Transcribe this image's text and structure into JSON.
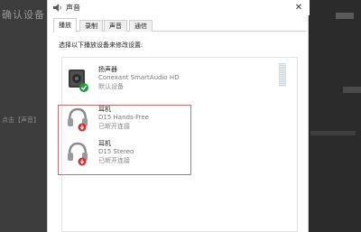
{
  "background": {
    "title": "确认设备",
    "side_text": "点击【声音】"
  },
  "dialog": {
    "title": "声音",
    "close_symbol": "✕"
  },
  "tabs": [
    {
      "label": "播放",
      "active": true
    },
    {
      "label": "录制",
      "active": false
    },
    {
      "label": "声音",
      "active": false
    },
    {
      "label": "通信",
      "active": false
    }
  ],
  "panel_label": "选择以下播放设备来修改设置:",
  "devices": [
    {
      "name": "扬声器",
      "subtitle": "Conexant SmartAudio HD",
      "status": "默认设备",
      "icon": "speaker-icon",
      "badge": "default-check-icon"
    },
    {
      "name": "耳机",
      "subtitle": "D15 Hands-Free",
      "status": "已断开连接",
      "icon": "headphones-icon",
      "badge": "disconnected-icon"
    },
    {
      "name": "耳机",
      "subtitle": "D15 Stereo",
      "status": "已断开连接",
      "icon": "headphones-icon",
      "badge": "disconnected-icon"
    }
  ],
  "colors": {
    "check_green": "#1e9b3a",
    "disconnected_red": "#d0312d",
    "highlight_border": "#c07070"
  }
}
